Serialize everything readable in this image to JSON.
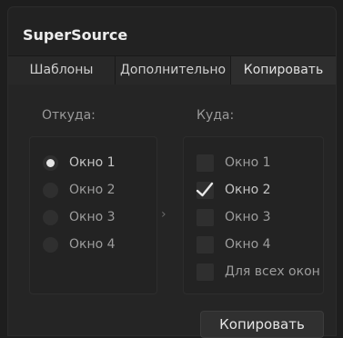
{
  "panel": {
    "title": "SuperSource"
  },
  "tabs": [
    {
      "label": "Шаблоны",
      "active": false
    },
    {
      "label": "Дополнительно",
      "active": false
    },
    {
      "label": "Копировать",
      "active": true
    }
  ],
  "from": {
    "label": "Откуда:",
    "options": [
      {
        "label": "Окно 1",
        "selected": true
      },
      {
        "label": "Окно 2",
        "selected": false
      },
      {
        "label": "Окно 3",
        "selected": false
      },
      {
        "label": "Окно 4",
        "selected": false
      }
    ]
  },
  "to": {
    "label": "Куда:",
    "options": [
      {
        "label": "Окно 1",
        "checked": false
      },
      {
        "label": "Окно 2",
        "checked": true
      },
      {
        "label": "Окно 3",
        "checked": false
      },
      {
        "label": "Окно 4",
        "checked": false
      },
      {
        "label": "Для всех окон",
        "checked": false
      }
    ]
  },
  "arrow_glyph": "›",
  "copy_button": {
    "label": "Копировать"
  },
  "icons": {
    "arrow": "chevron-right-icon",
    "check": "checkmark-icon"
  }
}
